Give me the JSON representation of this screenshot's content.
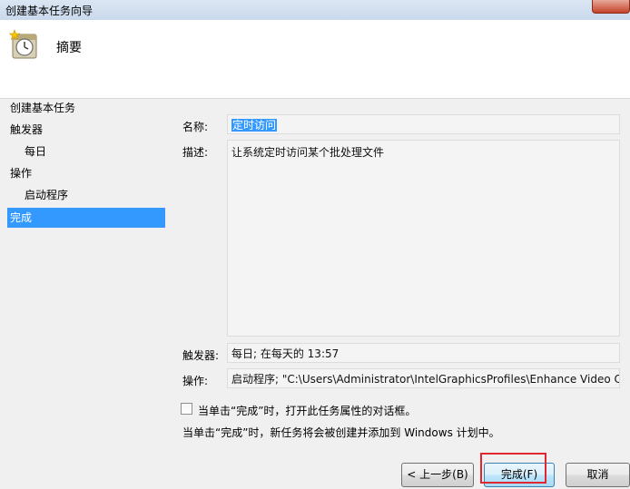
{
  "window": {
    "title": "创建基本任务向导"
  },
  "header": {
    "title": "摘要",
    "icon": "clock-task-icon"
  },
  "nav": {
    "items": [
      {
        "label": "创建基本任务",
        "sub": false,
        "active": false
      },
      {
        "label": "触发器",
        "sub": false,
        "active": false
      },
      {
        "label": "每日",
        "sub": true,
        "active": false
      },
      {
        "label": "操作",
        "sub": false,
        "active": false
      },
      {
        "label": "启动程序",
        "sub": true,
        "active": false
      },
      {
        "label": "完成",
        "sub": false,
        "active": true
      }
    ]
  },
  "form": {
    "name_label": "名称:",
    "name_value": "定时访问",
    "desc_label": "描述:",
    "desc_value": "让系统定时访问某个批处理文件",
    "trigger_label": "触发器:",
    "trigger_value": "每日; 在每天的 13:57",
    "action_label": "操作:",
    "action_value": "启动程序; \"C:\\Users\\Administrator\\IntelGraphicsProfiles\\Enhance Video Co"
  },
  "options": {
    "open_properties_label": "当单击“完成”时，打开此任务属性的对话框。",
    "open_properties_checked": false,
    "info_text": "当单击“完成”时，新任务将会被创建并添加到 Windows 计划中。"
  },
  "buttons": {
    "back": "< 上一步(B)",
    "finish": "完成(F)",
    "cancel": "取消"
  },
  "colors": {
    "selection": "#3399ff",
    "highlight": "#e0262e"
  }
}
